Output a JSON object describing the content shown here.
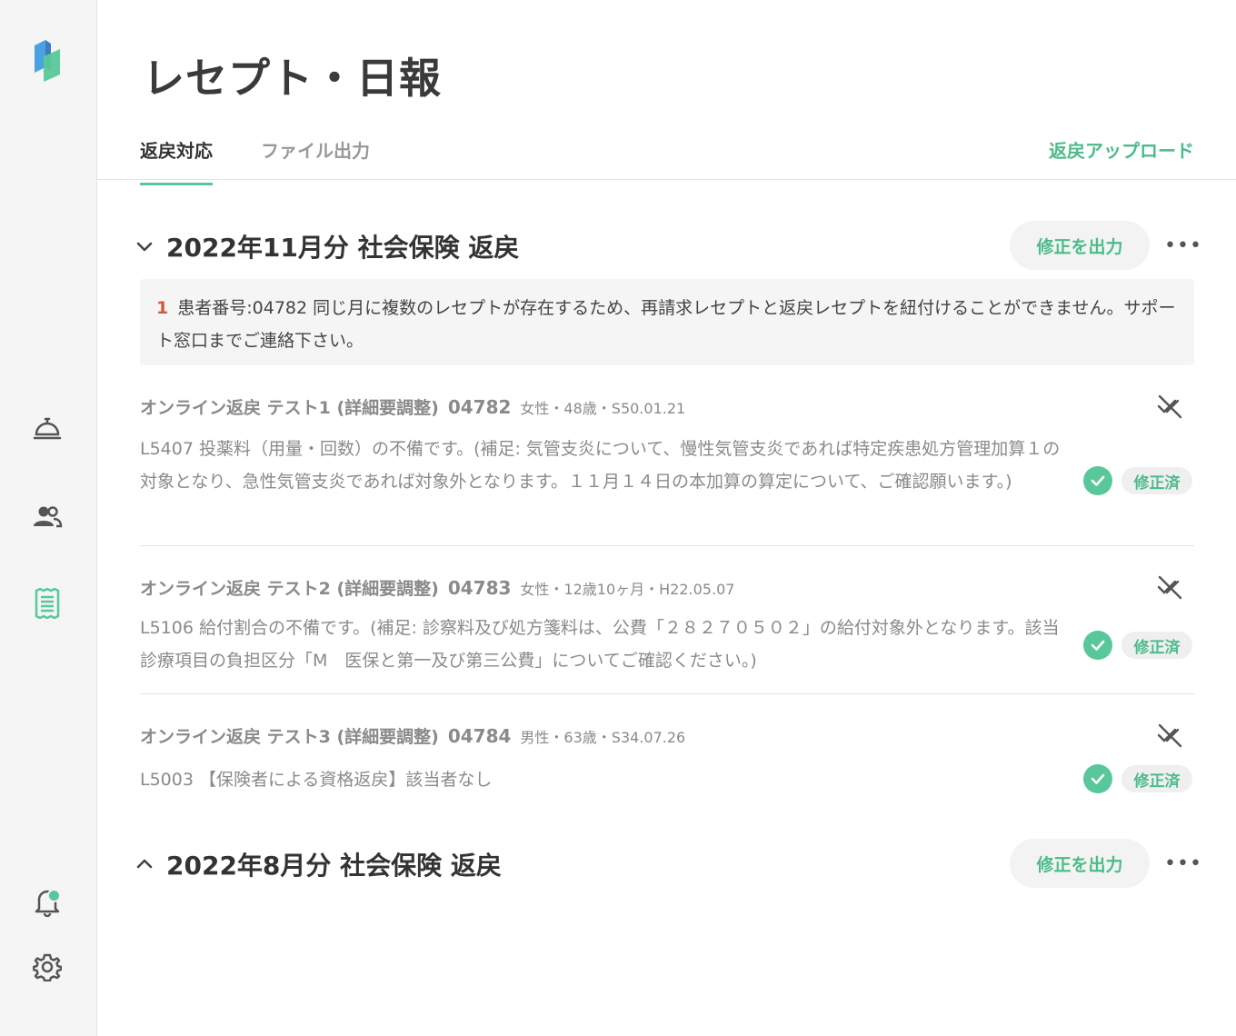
{
  "page": {
    "title": "レセプト・日報"
  },
  "tabs": [
    {
      "label": "返戻対応",
      "active": true
    },
    {
      "label": "ファイル出力",
      "active": false
    }
  ],
  "upload_label": "返戻アップロード",
  "sections": [
    {
      "title": "2022年11月分 社会保険 返戻",
      "expanded": true,
      "export_label": "修正を出力",
      "more_label": "•••",
      "alert": {
        "number": "1",
        "text": "患者番号:04782 同じ月に複数のレセプトが存在するため、再請求レセプトと返戻レセプトを紐付けることができません。サポート窓口までご連絡下さい。"
      },
      "items": [
        {
          "name": "オンライン返戻 テスト1 (詳細要調整)",
          "patient_id": "04782",
          "meta": "女性・48歳・S50.01.21",
          "body": "L5407 投薬料（用量・回数）の不備です。(補足: 気管支炎について、慢性気管支炎であれば特定疾患処方管理加算１の対象となり、急性気管支炎であれば対象外となります。１１月１４日の本加算の算定について、ご確認願います。)",
          "status": "修正済"
        },
        {
          "name": "オンライン返戻 テスト2 (詳細要調整)",
          "patient_id": "04783",
          "meta": "女性・12歳10ヶ月・H22.05.07",
          "body": "L5106 給付割合の不備です。(補足: 診察料及び処方箋料は、公費「２８２７０５０２」の給付対象外となります。該当診療項目の負担区分「M　医保と第一及び第三公費」についてご確認ください。)",
          "status": "修正済"
        },
        {
          "name": "オンライン返戻 テスト3 (詳細要調整)",
          "patient_id": "04784",
          "meta": "男性・63歳・S34.07.26",
          "body": "L5003 【保険者による資格返戻】該当者なし",
          "status": "修正済"
        }
      ]
    },
    {
      "title": "2022年8月分 社会保険 返戻",
      "expanded": false,
      "export_label": "修正を出力",
      "more_label": "•••"
    }
  ],
  "colors": {
    "accent": "#58c89a",
    "accent_text": "#4cbb8a",
    "alert_number": "#d0593a"
  }
}
